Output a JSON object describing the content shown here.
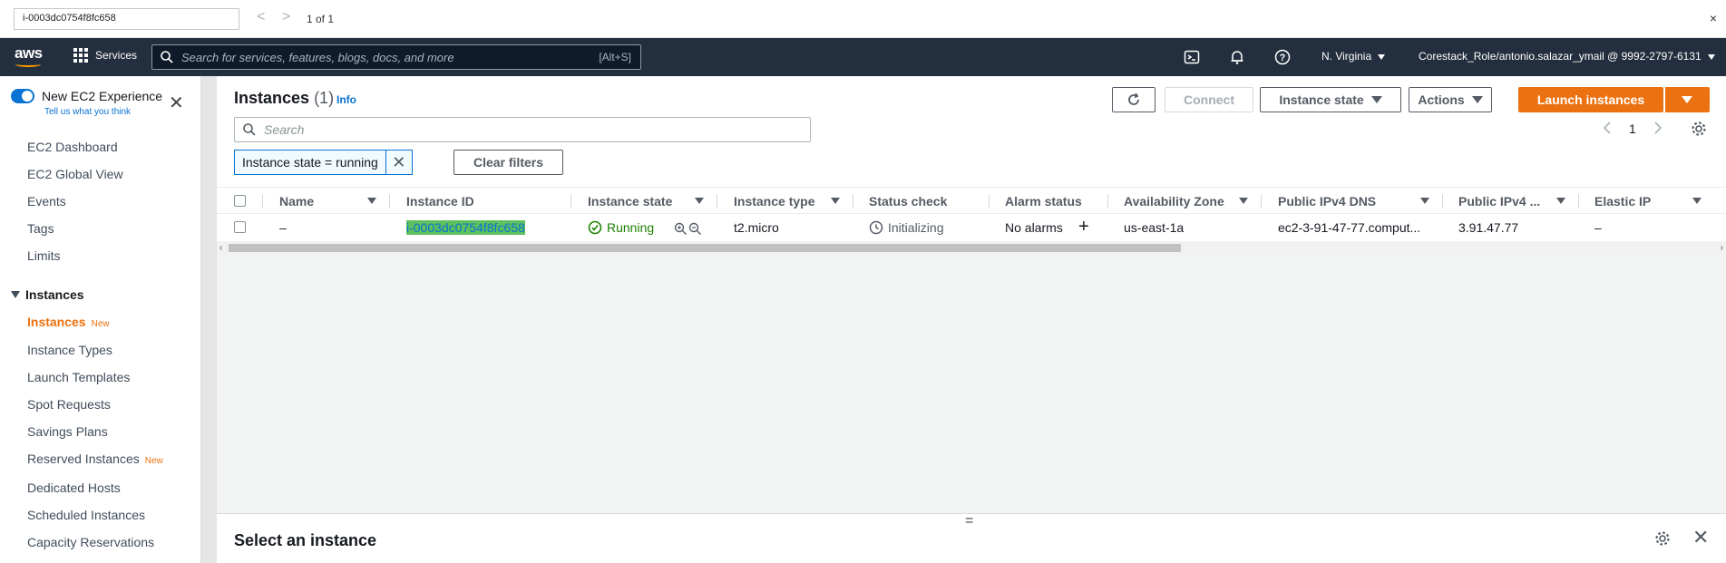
{
  "findbar": {
    "query": "i-0003dc0754f8fc658",
    "prev": "<",
    "next": ">",
    "count": "1 of 1",
    "close": "×"
  },
  "topnav": {
    "logo": "aws",
    "services": "Services",
    "search_placeholder": "Search for services, features, blogs, docs, and more",
    "search_shortcut": "[Alt+S]",
    "region": "N. Virginia",
    "account": "Corestack_Role/antonio.salazar_ymail @ 9992-2797-6131"
  },
  "sidebar": {
    "experience_label": "New EC2 Experience",
    "experience_sub": "Tell us what you think",
    "top_items": [
      "EC2 Dashboard",
      "EC2 Global View",
      "Events",
      "Tags",
      "Limits"
    ],
    "group": "Instances",
    "group_items": [
      {
        "label": "Instances",
        "badge": "New"
      },
      {
        "label": "Instance Types",
        "badge": ""
      },
      {
        "label": "Launch Templates",
        "badge": ""
      },
      {
        "label": "Spot Requests",
        "badge": ""
      },
      {
        "label": "Savings Plans",
        "badge": ""
      },
      {
        "label": "Reserved Instances",
        "badge": "New"
      },
      {
        "label": "Dedicated Hosts",
        "badge": ""
      },
      {
        "label": "Scheduled Instances",
        "badge": ""
      },
      {
        "label": "Capacity Reservations",
        "badge": ""
      }
    ]
  },
  "header": {
    "title": "Instances",
    "count": "(1)",
    "info": "Info",
    "connect": "Connect",
    "instance_state": "Instance state",
    "actions": "Actions",
    "launch": "Launch instances"
  },
  "filter": {
    "placeholder": "Search",
    "token": "Instance state = running",
    "clear": "Clear filters",
    "page": "1"
  },
  "table": {
    "columns": [
      "Name",
      "Instance ID",
      "Instance state",
      "Instance type",
      "Status check",
      "Alarm status",
      "Availability Zone",
      "Public IPv4 DNS",
      "Public IPv4 ...",
      "Elastic IP"
    ],
    "row": {
      "name": "–",
      "instance_id": "i-0003dc0754f8fc658",
      "state": "Running",
      "type": "t2.micro",
      "status_check": "Initializing",
      "alarm": "No alarms",
      "az": "us-east-1a",
      "dns": "ec2-3-91-47-77.comput...",
      "ipv4": "3.91.47.77",
      "elastic_ip": "–"
    }
  },
  "detail": {
    "title": "Select an instance"
  },
  "colors": {
    "nav_bg": "#232f3e",
    "accent_orange": "#ec7211",
    "link_blue": "#0972d3",
    "running_green": "#1d8102",
    "highlight": "#5ec15e"
  }
}
